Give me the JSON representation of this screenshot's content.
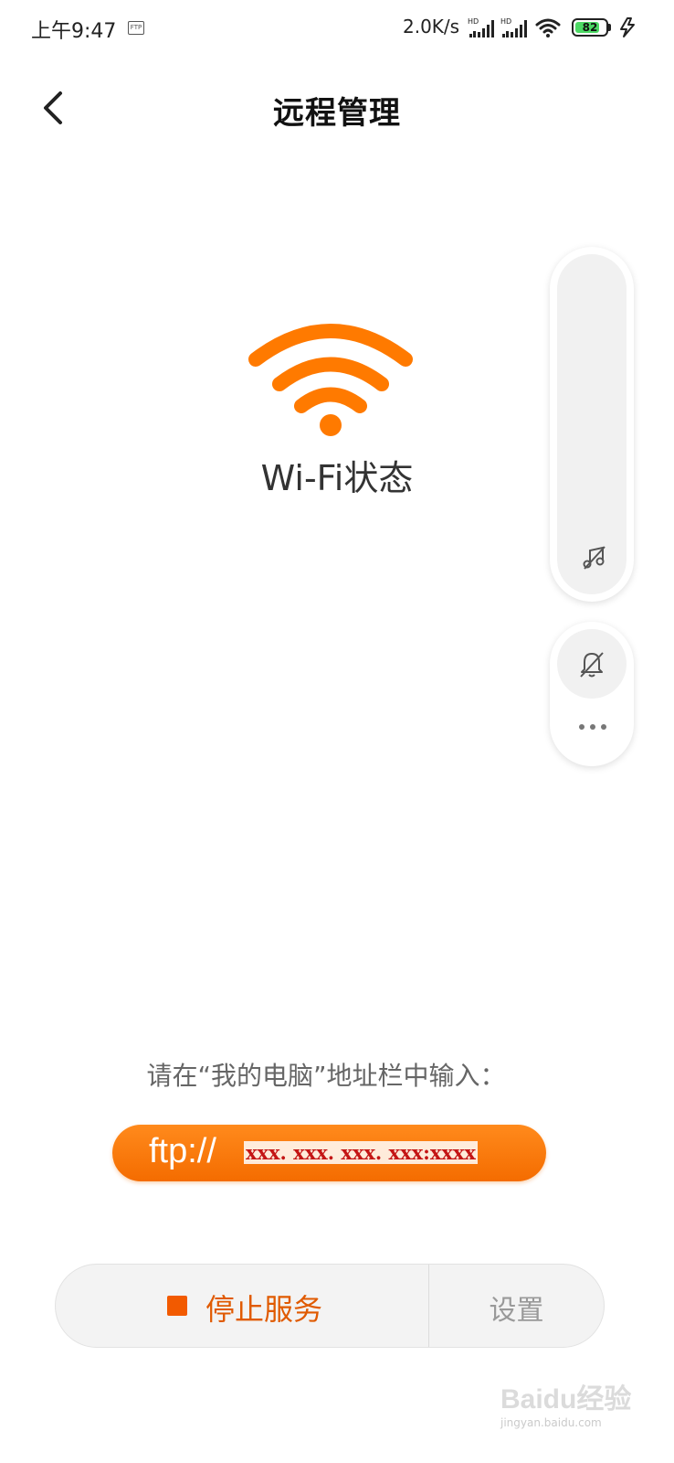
{
  "status_bar": {
    "time": "上午9:47",
    "ftp_badge": "FTP",
    "speed": "2.0K/s",
    "battery_level": "82",
    "battery_fraction": 0.82,
    "icons": [
      "ftp-icon",
      "signal-icon",
      "signal-icon",
      "wifi-icon",
      "battery-icon",
      "charging-icon"
    ]
  },
  "header": {
    "title": "远程管理",
    "back_icon": "chevron-left-icon"
  },
  "wifi": {
    "icon": "wifi-icon",
    "label": "Wi-Fi状态",
    "color": "#ff7a00"
  },
  "float_panel": {
    "icons": [
      "music-off-icon",
      "bell-off-icon",
      "more-icon"
    ]
  },
  "instruction": "请在“我的电脑”地址栏中输入：",
  "url": {
    "prefix": "ftp://",
    "address": "xxx. xxx. xxx. xxx:xxxx"
  },
  "actions": {
    "stop_label": "停止服务",
    "settings_label": "设置",
    "stop_color": "#f25a00"
  },
  "watermark": {
    "text": "Baidu经验",
    "sub": "jingyan.baidu.com"
  }
}
